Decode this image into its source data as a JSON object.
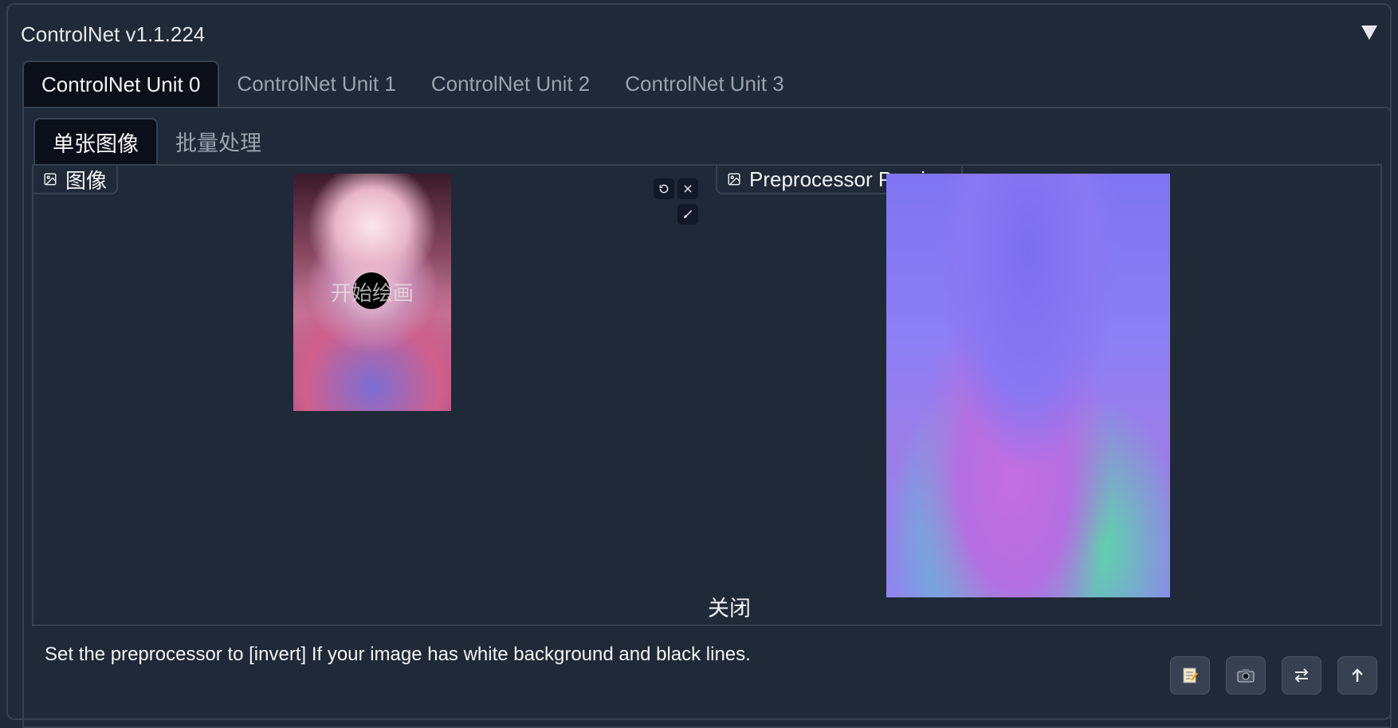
{
  "panel": {
    "title": "ControlNet v1.1.224",
    "collapse_icon": "triangle-down-icon"
  },
  "unit_tabs": [
    {
      "label": "ControlNet Unit 0",
      "active": true
    },
    {
      "label": "ControlNet Unit 1",
      "active": false
    },
    {
      "label": "ControlNet Unit 2",
      "active": false
    },
    {
      "label": "ControlNet Unit 3",
      "active": false
    }
  ],
  "mode_tabs": [
    {
      "label": "单张图像",
      "active": true
    },
    {
      "label": "批量处理",
      "active": false
    }
  ],
  "image_input": {
    "label": "图像",
    "watermark": "开始绘画",
    "icons": [
      "undo-icon",
      "close-icon",
      "brush-icon"
    ]
  },
  "preview": {
    "label": "Preprocessor Preview",
    "close_label": "关闭"
  },
  "hint": "Set the preprocessor to [invert] If your image has white background and black lines.",
  "toolbar": {
    "icons": [
      "notepad-icon",
      "camera-icon",
      "swap-icon",
      "upload-arrow-icon"
    ]
  },
  "colors": {
    "background": "#1f2937",
    "active_tab": "#0b0f19",
    "border": "#374151"
  }
}
